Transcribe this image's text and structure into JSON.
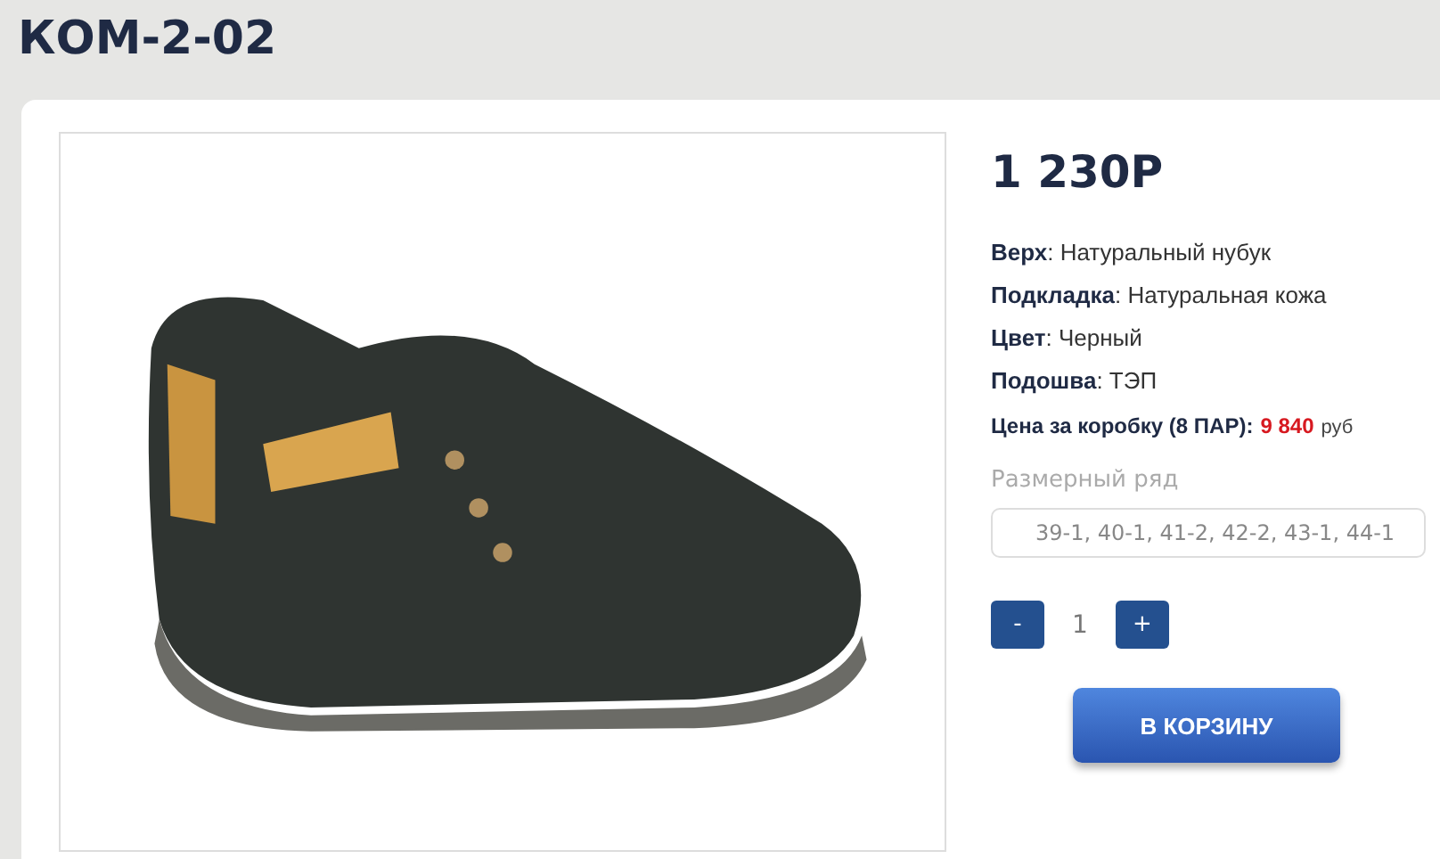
{
  "title": "КОМ-2-02",
  "price": "1 230Р",
  "specs": [
    "**Верх**: Натуральный нубук",
    "**Подкладка**: Натуральная кожа",
    "**Цвет**: Черный",
    "**Подошва**: ТЭП"
  ],
  "box_price": {
    "label": "Цена за коробку (8 ПАР):",
    "value": "9 840",
    "unit": "руб"
  },
  "size_range": {
    "label": "Размерный ряд",
    "value": "39-1, 40-1, 41-2, 42-2, 43-1, 44-1"
  },
  "quantity": {
    "minus": "-",
    "value": "1",
    "plus": "+"
  },
  "cart_button": "В КОРЗИНУ"
}
